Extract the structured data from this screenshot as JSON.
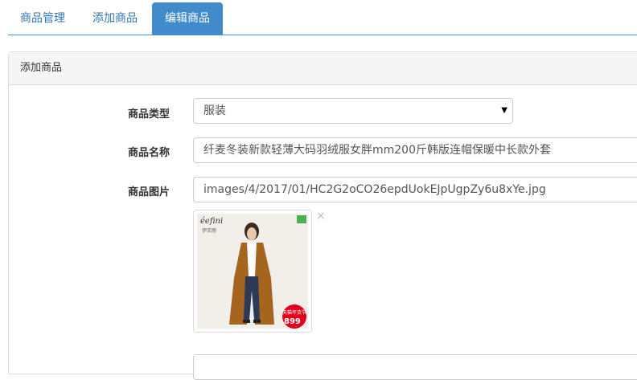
{
  "tabs": [
    {
      "label": "商品管理"
    },
    {
      "label": "添加商品"
    },
    {
      "label": "编辑商品"
    }
  ],
  "panel": {
    "title": "添加商品"
  },
  "form": {
    "type": {
      "label": "商品类型",
      "value": "服装"
    },
    "name": {
      "label": "商品名称",
      "value": "纤麦冬装新款轻薄大码羽绒服女胖mm200斤韩版连帽保暖中长款外套"
    },
    "image": {
      "label": "商品图片",
      "value": "images/4/2017/01/HC2G2oCO26epdUokEJpUgpZy6u8xYe.jpg"
    }
  },
  "preview": {
    "brand_logo": "éefini",
    "brand_sub": "伊芙丽",
    "price_badge": "899",
    "sale_tag": "天猫年货节"
  },
  "icons": {
    "close": "×",
    "dropdown": "▼"
  },
  "colors": {
    "accent": "#428bca",
    "tab_text": "#3276b1",
    "price_red": "#e0001b"
  }
}
